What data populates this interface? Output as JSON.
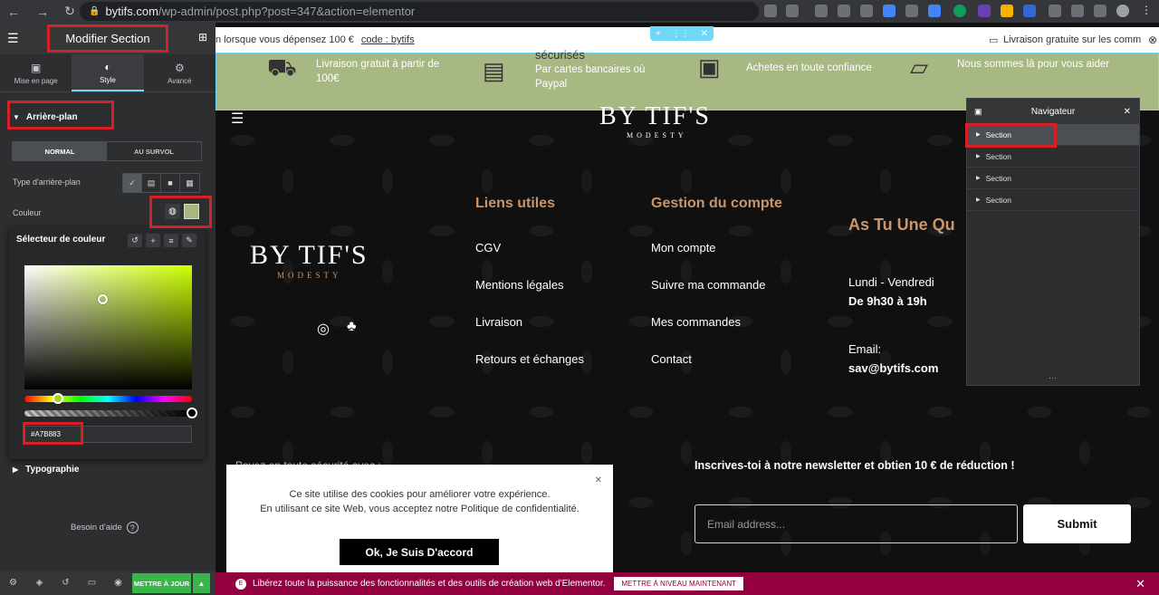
{
  "browser": {
    "domain": "bytifs.com",
    "path": "/wp-admin/post.php?post=347&action=elementor"
  },
  "sidebar": {
    "title": "Modifier Section",
    "tabs": [
      {
        "label": "Mise en page"
      },
      {
        "label": "Style"
      },
      {
        "label": "Avancé"
      }
    ],
    "section_title": "Arrière-plan",
    "toggle": {
      "normal": "NORMAL",
      "hover": "AU SURVOL"
    },
    "bg_type_label": "Type d'arrière-plan",
    "color_label": "Couleur",
    "picker": {
      "title": "Sélecteur de couleur",
      "hex": "#A7B883"
    },
    "typography": "Typographie",
    "help": "Besoin d'aide",
    "update_label": "METTRE À JOUR"
  },
  "colors": {
    "accent": "#a7b883",
    "brand": "#c9956b",
    "elementor": "#93003f",
    "highlight": "#d62027"
  },
  "site": {
    "topbar_left": "n lorsque vous dépensez 100 €",
    "topbar_code": "code : bytifs",
    "topbar_right": "Livraison gratuite sur les comm",
    "features": [
      {
        "title": "",
        "desc": "Livraison gratuit à partir de 100€"
      },
      {
        "title": "sécurisés",
        "desc": "Par cartes bancaires où Paypal"
      },
      {
        "title": "",
        "desc": "Achetes en toute confiance"
      },
      {
        "title": "",
        "desc": "Nous sommes là pour vous aider"
      }
    ],
    "logo": "BY TIF'S",
    "logo_sub": "MODESTY",
    "links_title": "Liens utiles",
    "links": [
      "CGV",
      "Mentions légales",
      "Livraison",
      "Retours et échanges"
    ],
    "account_title": "Gestion du compte",
    "account": [
      "Mon compte",
      "Suivre ma commande",
      "Mes commandes",
      "Contact"
    ],
    "contact_title": "As Tu Une Qu",
    "hours_label": "Lundi - Vendredi",
    "hours": "De 9h30 à 19h",
    "email_label": "Email:",
    "email": "sav@bytifs.com",
    "secure_text": "Payez en toute sécurité avec :",
    "cookie_line1": "Ce site utilise des cookies pour améliorer votre expérience.",
    "cookie_line2": "En utilisant ce site Web, vous acceptez notre Politique de confidentialité.",
    "cookie_btn": "Ok, Je Suis D'accord",
    "newsletter": "Inscrives-toi à notre newsletter et obtien 10 € de réduction !",
    "email_placeholder": "Email address...",
    "submit": "Submit"
  },
  "navigator": {
    "title": "Navigateur",
    "items": [
      "Section",
      "Section",
      "Section",
      "Section"
    ]
  },
  "promo": {
    "text": "Libérez toute la puissance des fonctionnalités et des outils de création web d'Elementor.",
    "button": "METTRE À NIVEAU MAINTENANT"
  }
}
